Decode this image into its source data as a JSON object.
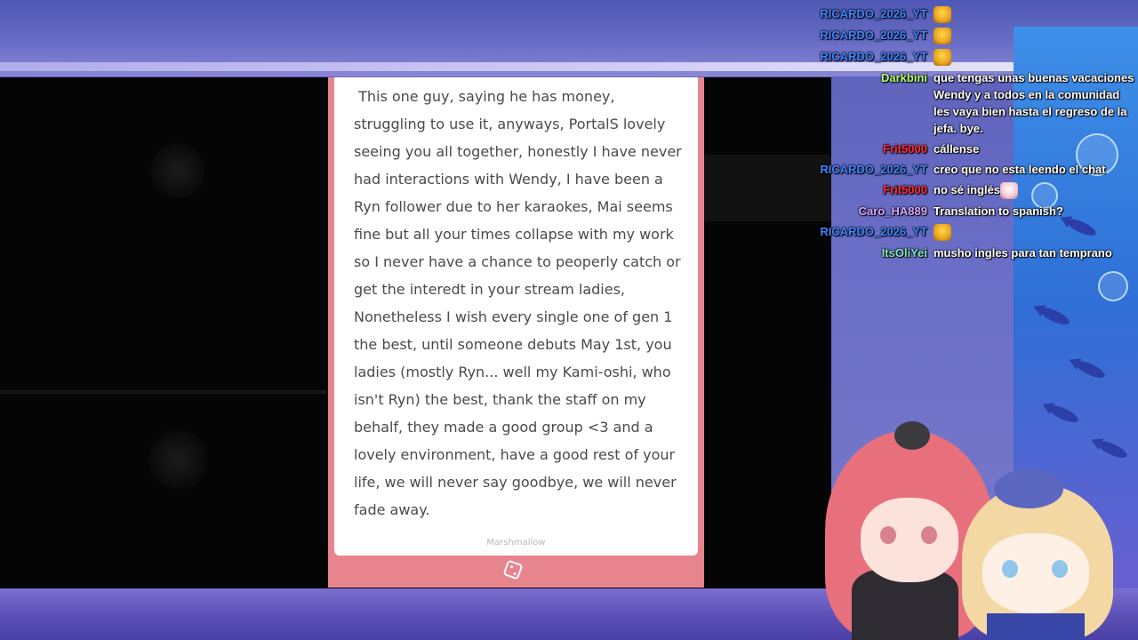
{
  "marshmallow": {
    "message": " This one guy, saying he has money, struggling to use it, anyways, PortalS lovely seeing you all together, honestly I have never had interactions with Wendy, I have been a Ryn follower due to her karaokes, Mai seems fine but all your times collapse with my work so I never have a chance to peoperly catch or get the interedt in your stream ladies, Nonetheless I wish every single one of gen 1 the best, until someone debuts May 1st, you ladies (mostly Ryn... well my Kami-oshi, who isn't Ryn) the best, thank the staff on my behalf, they made a good group <3 and a lovely environment, have a good rest of your life, we will never say goodbye, we will never fade away.",
    "footer_label": "Marshmallow",
    "dice_icon": "dice-icon"
  },
  "chat": {
    "messages": [
      {
        "user": "RICARDO_2026_YT",
        "color": "#3f84ff",
        "text": "",
        "emote": "gold"
      },
      {
        "user": "RICARDO_2026_YT",
        "color": "#3f84ff",
        "text": "",
        "emote": "gold"
      },
      {
        "user": "RICARDO_2026_YT",
        "color": "#3f84ff",
        "text": "",
        "emote": "gold"
      },
      {
        "user": "Darkbini",
        "color": "#b5ff74",
        "text": "que tengas unas buenas vacaciones Wendy y a todos en la comunidad les vaya bien hasta el regreso de la jefa. bye.",
        "emote": ""
      },
      {
        "user": "Frit5000",
        "color": "#ff2a3a",
        "text": "cállense",
        "emote": ""
      },
      {
        "user": "RICARDO_2026_YT",
        "color": "#3f84ff",
        "text": "creo que no esta leendo el chat",
        "emote": ""
      },
      {
        "user": "Frit5000",
        "color": "#ff2a3a",
        "text": "no sé inglés",
        "emote": "alt"
      },
      {
        "user": "Caro_HA889",
        "color": "#d9a6ff",
        "text": "Translation to spanish?",
        "emote": ""
      },
      {
        "user": "RICARDO_2026_YT",
        "color": "#3f84ff",
        "text": "",
        "emote": "gold"
      },
      {
        "user": "ItsOliYei",
        "color": "#7fe7c4",
        "text": "musho ingles para tan temprano",
        "emote": ""
      }
    ]
  },
  "colors": {
    "card_border": "#e8848e",
    "banner_top": "#4e57b3",
    "banner_bottom": "#5e52b8",
    "video_bg": "#050505"
  }
}
